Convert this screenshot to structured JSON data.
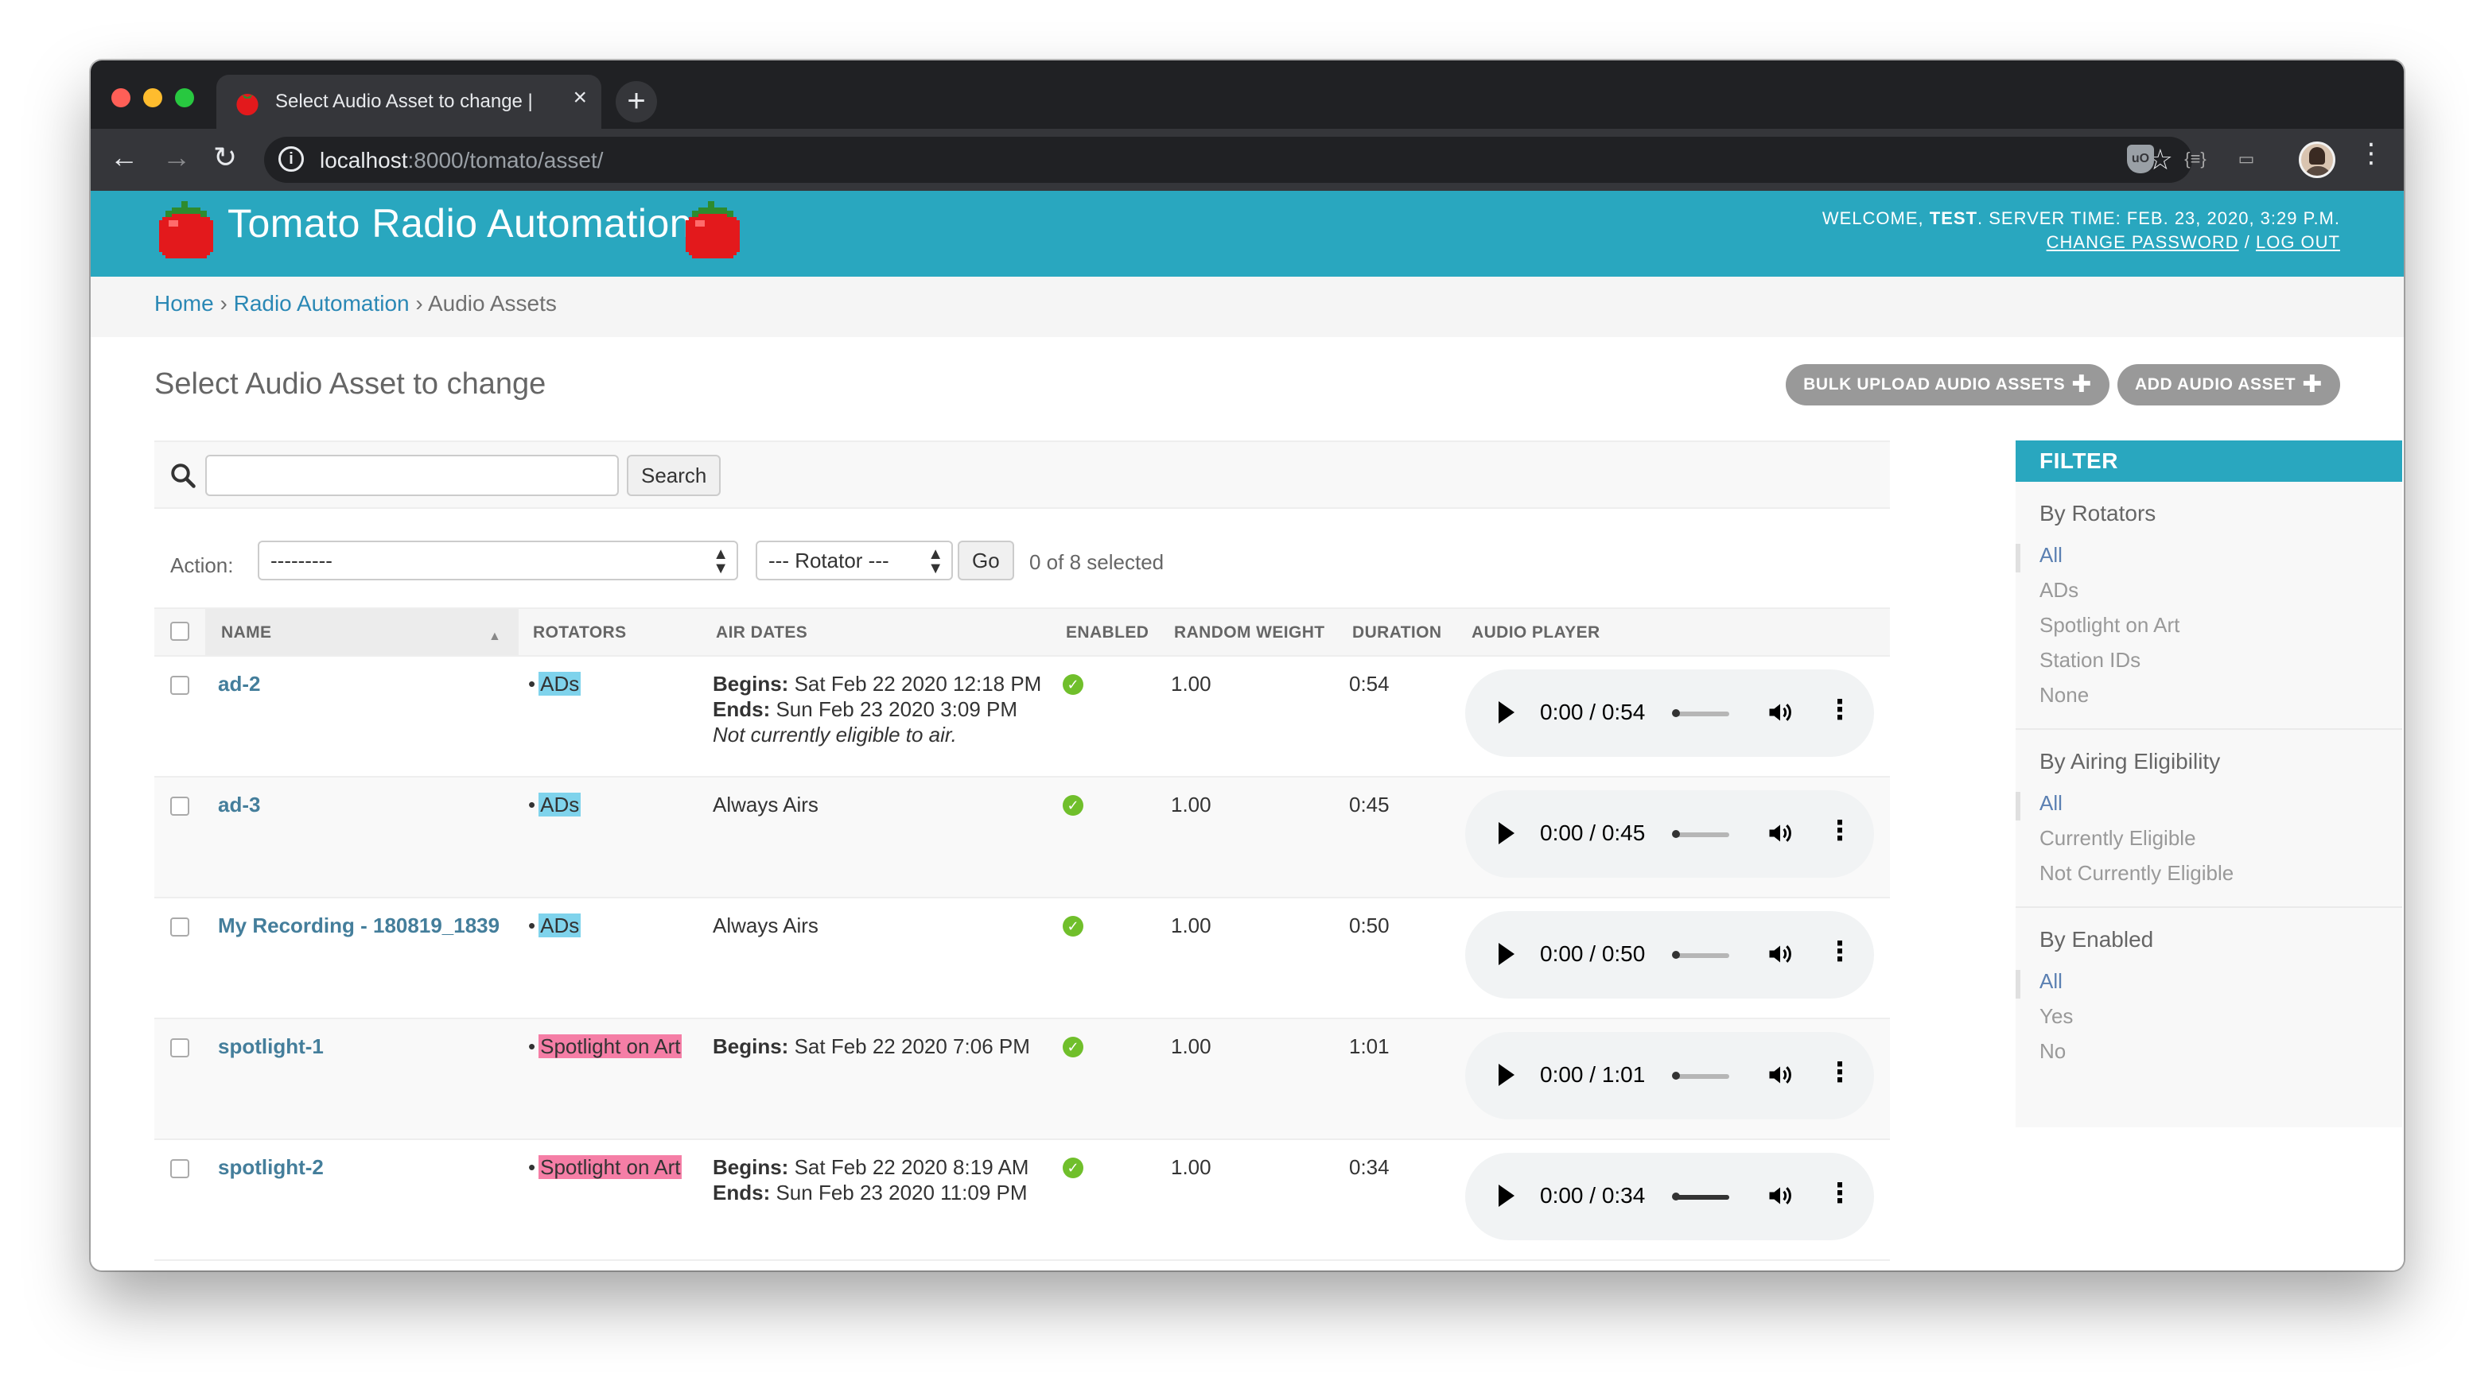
{
  "browser": {
    "tab_title": "Select Audio Asset to change |",
    "tab_close": "×",
    "new_tab": "+",
    "url_host": "localhost",
    "url_path": ":8000/tomato/asset/",
    "nav_back": "←",
    "nav_forward": "→",
    "nav_reload": "↻",
    "bookmark": "☆",
    "ext_ublock": "uO",
    "ext_json": "{≡}",
    "ext_cast": "▭",
    "menu": "⋮"
  },
  "header": {
    "brand": "Tomato Radio Automation",
    "welcome": "WELCOME,",
    "user": "TEST",
    "server_time": ". SERVER TIME: FEB. 23, 2020, 3:29 P.M.",
    "change_password": "CHANGE PASSWORD",
    "separator": "/",
    "log_out": "LOG OUT",
    "brand_color": "#29a7bf"
  },
  "breadcrumbs": {
    "home": "Home",
    "sep1": " › ",
    "app": "Radio Automation",
    "sep2": " › ",
    "current": "Audio Assets"
  },
  "page": {
    "title": "Select Audio Asset to change",
    "bulk_upload": "BULK UPLOAD AUDIO ASSETS",
    "add_asset": "ADD AUDIO ASSET",
    "plus": "✚"
  },
  "search": {
    "value": "",
    "button": "Search"
  },
  "actions": {
    "label": "Action:",
    "action_value": "---------",
    "rotator_value": "--- Rotator ---",
    "go": "Go",
    "selected": "0 of 8 selected"
  },
  "columns": {
    "name": "NAME",
    "rotators": "ROTATORS",
    "air_dates": "AIR DATES",
    "enabled": "ENABLED",
    "random_weight": "RANDOM WEIGHT",
    "duration": "DURATION",
    "audio_player": "AUDIO PLAYER"
  },
  "rows": [
    {
      "name": "ad-2",
      "rotator": "ADs",
      "rotator_color": "#7fd3ec",
      "begins_label": "Begins:",
      "begins": " Sat Feb 22 2020 12:18 PM",
      "ends_label": "Ends:",
      "ends": " Sun Feb 23 2020 3:09 PM",
      "note": "Not currently eligible to air.",
      "always": "",
      "weight": "1.00",
      "duration": "0:54",
      "player_time": "0:00 / 0:54",
      "progress": 0
    },
    {
      "name": "ad-3",
      "rotator": "ADs",
      "rotator_color": "#7fd3ec",
      "begins_label": "",
      "begins": "",
      "ends_label": "",
      "ends": "",
      "note": "",
      "always": "Always Airs",
      "weight": "1.00",
      "duration": "0:45",
      "player_time": "0:00 / 0:45",
      "progress": 0
    },
    {
      "name": "My Recording - 180819_1839",
      "rotator": "ADs",
      "rotator_color": "#7fd3ec",
      "begins_label": "",
      "begins": "",
      "ends_label": "",
      "ends": "",
      "note": "",
      "always": "Always Airs",
      "weight": "1.00",
      "duration": "0:50",
      "player_time": "0:00 / 0:50",
      "progress": 0
    },
    {
      "name": "spotlight-1",
      "rotator": "Spotlight on Art",
      "rotator_color": "#f57ea6",
      "begins_label": "Begins:",
      "begins": " Sat Feb 22 2020 7:06 PM",
      "ends_label": "",
      "ends": "",
      "note": "",
      "always": "",
      "weight": "1.00",
      "duration": "1:01",
      "player_time": "0:00 / 1:01",
      "progress": 0
    },
    {
      "name": "spotlight-2",
      "rotator": "Spotlight on Art",
      "rotator_color": "#f57ea6",
      "begins_label": "Begins:",
      "begins": " Sat Feb 22 2020 8:19 AM",
      "ends_label": "Ends:",
      "ends": " Sun Feb 23 2020 11:09 PM",
      "note": "",
      "always": "",
      "weight": "1.00",
      "duration": "0:34",
      "player_time": "0:00 / 0:34",
      "progress": 1
    }
  ],
  "filter": {
    "header": "FILTER",
    "groups": [
      {
        "title": "By Rotators",
        "items": [
          "All",
          "ADs",
          "Spotlight on Art",
          "Station IDs",
          "None"
        ],
        "selected": 0
      },
      {
        "title": "By Airing Eligibility",
        "items": [
          "All",
          "Currently Eligible",
          "Not Currently Eligible"
        ],
        "selected": 0
      },
      {
        "title": "By Enabled",
        "items": [
          "All",
          "Yes",
          "No"
        ],
        "selected": 0
      }
    ]
  }
}
